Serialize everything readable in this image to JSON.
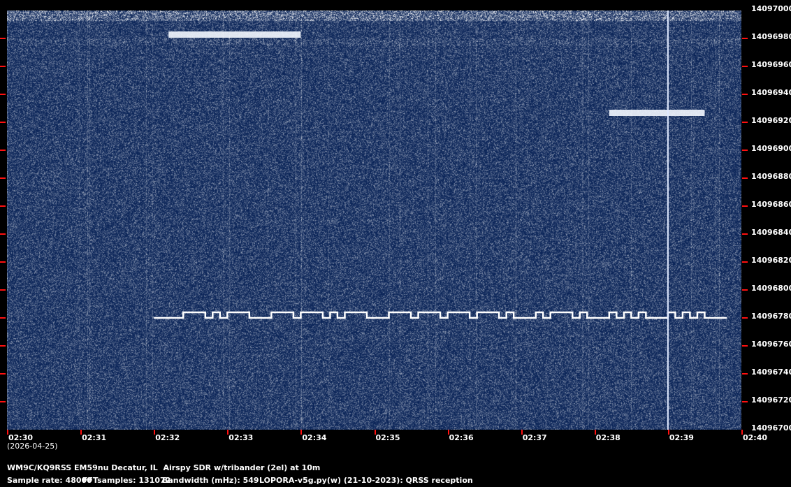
{
  "chart_data": {
    "type": "heatmap",
    "title": "",
    "xlabel": "",
    "ylabel": "",
    "x_tick_labels": [
      "02:30",
      "02:31",
      "02:32",
      "02:33",
      "02:34",
      "02:35",
      "02:36",
      "02:37",
      "02:38",
      "02:39",
      "02:40"
    ],
    "date_label": "(2026-04-25)",
    "y_tick_labels": [
      "14097000",
      "14096980",
      "14096960",
      "14096940",
      "14096920",
      "14096900",
      "14096880",
      "14096860",
      "14096840",
      "14096820",
      "14096800",
      "14096780",
      "14096760",
      "14096740",
      "14096720",
      "14096700"
    ],
    "xlim": [
      "02:30",
      "02:40"
    ],
    "ylim": [
      14096700,
      14097000
    ],
    "colormap": {
      "low": "#0a2458",
      "high": "#ffffff"
    },
    "tick_color": "#ff1010",
    "signals": [
      {
        "kind": "fsk",
        "start": "02:32:00",
        "end": "02:39:48",
        "freq_low": 14096780,
        "freq_high": 14096784,
        "high_segments": [
          [
            "02:32:24",
            "02:32:42"
          ],
          [
            "02:32:48",
            "02:32:54"
          ],
          [
            "02:33:00",
            "02:33:18"
          ],
          [
            "02:33:36",
            "02:33:54"
          ],
          [
            "02:34:00",
            "02:34:18"
          ],
          [
            "02:34:24",
            "02:34:30"
          ],
          [
            "02:34:36",
            "02:34:54"
          ],
          [
            "02:35:12",
            "02:35:30"
          ],
          [
            "02:35:36",
            "02:35:54"
          ],
          [
            "02:36:00",
            "02:36:18"
          ],
          [
            "02:36:24",
            "02:36:42"
          ],
          [
            "02:36:48",
            "02:36:54"
          ],
          [
            "02:37:12",
            "02:37:18"
          ],
          [
            "02:37:24",
            "02:37:42"
          ],
          [
            "02:37:48",
            "02:37:54"
          ],
          [
            "02:38:12",
            "02:38:18"
          ],
          [
            "02:38:24",
            "02:38:30"
          ],
          [
            "02:38:36",
            "02:38:42"
          ],
          [
            "02:39:00",
            "02:39:06"
          ],
          [
            "02:39:12",
            "02:39:18"
          ],
          [
            "02:39:24",
            "02:39:30"
          ]
        ]
      },
      {
        "kind": "band",
        "start": "02:32:12",
        "end": "02:34:00",
        "freq": 14096982
      },
      {
        "kind": "band",
        "start": "02:38:12",
        "end": "02:39:30",
        "freq": 14096926
      },
      {
        "kind": "vertical-line",
        "time": "02:39:00"
      }
    ]
  },
  "footer": {
    "station": "WM9C/KQ9RSS EM59nu Decatur, IL  Airspy SDR w/tribander (2el) at 10m",
    "sample_rate": "Sample rate: 48000",
    "fft": "FFTsamples: 131072",
    "bandwidth": "Bandwidth (mHz): 549",
    "software": "LOPORA-v5g.py(w) (21-10-2023): QRSS reception"
  }
}
